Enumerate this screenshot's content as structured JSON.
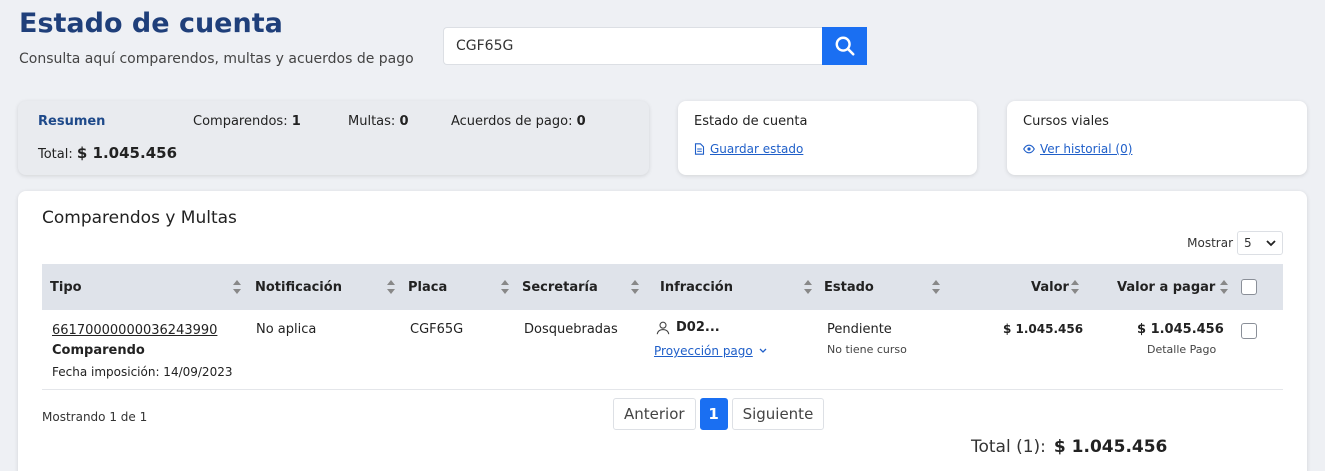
{
  "header": {
    "title": "Estado de cuenta",
    "subtitle": "Consulta aquí comparendos, multas y acuerdos de pago",
    "search_value": "CGF65G"
  },
  "summary": {
    "title": "Resumen",
    "comparendos_label": "Comparendos:",
    "comparendos_value": "1",
    "multas_label": "Multas:",
    "multas_value": "0",
    "acuerdos_label": "Acuerdos de pago:",
    "acuerdos_value": "0",
    "total_label": "Total:",
    "total_value": "$ 1.045.456"
  },
  "estado_card": {
    "title": "Estado de cuenta",
    "link": "Guardar estado"
  },
  "cursos_card": {
    "title": "Cursos viales",
    "link": "Ver historial (0)"
  },
  "main": {
    "title": "Comparendos y Multas",
    "show_label": "Mostrar",
    "show_value": "5",
    "columns": [
      "Tipo",
      "Notificación",
      "Placa",
      "Secretaría",
      "Infracción",
      "Estado",
      "Valor",
      "Valor a pagar"
    ],
    "row": {
      "numero": "66170000000036243990",
      "tipo": "Comparendo",
      "fecha": "Fecha imposición: 14/09/2023",
      "notificacion": "No aplica",
      "placa": "CGF65G",
      "secretaria": "Dosquebradas",
      "infraccion": "D02...",
      "proyeccion": "Proyección pago",
      "estado": "Pendiente",
      "curso": "No tiene curso",
      "valor": "$ 1.045.456",
      "valor_pagar": "$ 1.045.456",
      "detalle": "Detalle Pago"
    },
    "showing": "Mostrando 1 de 1",
    "pager": {
      "prev": "Anterior",
      "current": "1",
      "next": "Siguiente"
    },
    "total_label": "Total (1):",
    "total_value": "$ 1.045.456"
  },
  "colors": {
    "accent": "#1a6ff2",
    "title": "#1f3f7a",
    "link": "#1f5fc9"
  }
}
